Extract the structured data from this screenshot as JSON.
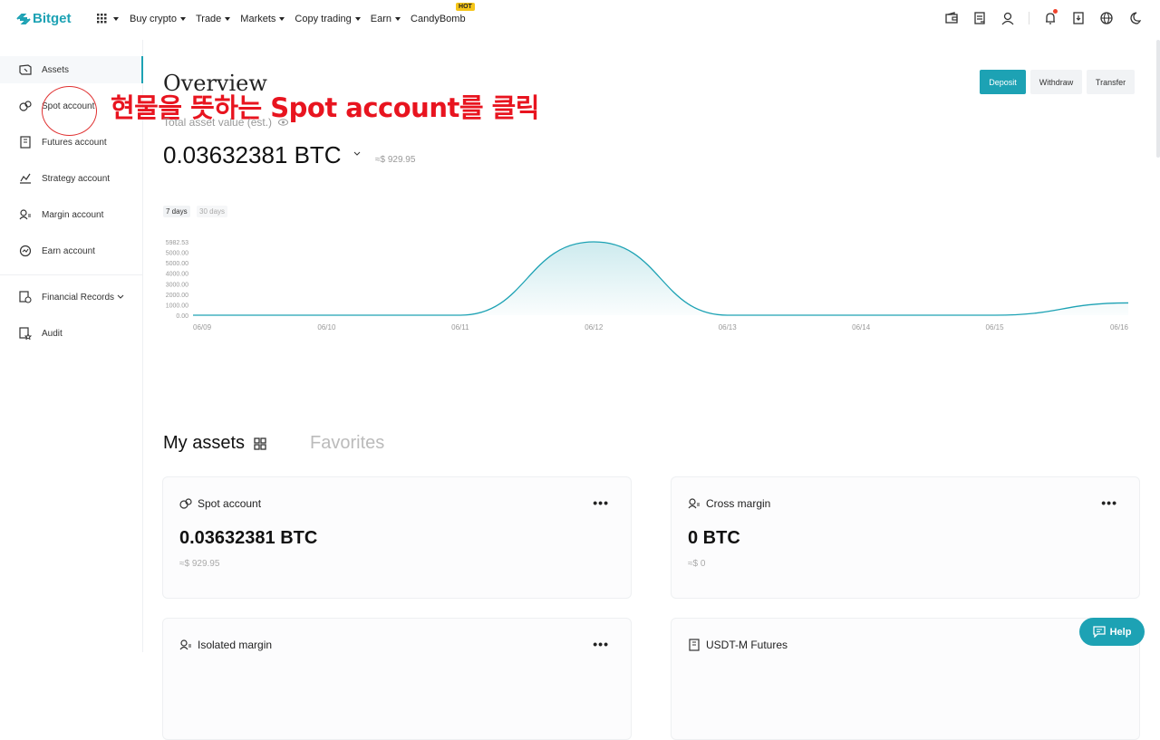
{
  "brand": {
    "name": "Bitget"
  },
  "nav": {
    "items": [
      {
        "label": "Buy crypto",
        "dropdown": true
      },
      {
        "label": "Trade",
        "dropdown": true
      },
      {
        "label": "Markets",
        "dropdown": true
      },
      {
        "label": "Copy trading",
        "dropdown": true
      },
      {
        "label": "Earn",
        "dropdown": true
      },
      {
        "label": "CandyBomb",
        "dropdown": false
      }
    ],
    "hot_badge": "HOT"
  },
  "header_icons": [
    "wallet-icon",
    "orders-icon",
    "user-icon",
    "bell-icon",
    "download-icon",
    "globe-icon",
    "moon-icon"
  ],
  "sidebar": {
    "items": [
      {
        "label": "Assets",
        "icon": "assets-icon"
      },
      {
        "label": "Spot account",
        "icon": "spot-icon"
      },
      {
        "label": "Futures account",
        "icon": "futures-icon"
      },
      {
        "label": "Strategy account",
        "icon": "strategy-icon"
      },
      {
        "label": "Margin account",
        "icon": "margin-icon"
      },
      {
        "label": "Earn account",
        "icon": "earn-icon"
      },
      {
        "label": "Financial Records",
        "icon": "records-icon"
      },
      {
        "label": "Audit",
        "icon": "audit-icon"
      }
    ]
  },
  "annotation": {
    "text": "현물을 뜻하는 Spot account를 클릭"
  },
  "overview": {
    "title": "Overview",
    "total_label": "Total asset value (est.)",
    "balance": "0.03632381 BTC",
    "balance_usd": "≈$ 929.95",
    "buttons": {
      "deposit": "Deposit",
      "withdraw": "Withdraw",
      "transfer": "Transfer"
    },
    "ranges": {
      "r7": "7 days",
      "r30": "30 days"
    }
  },
  "chart_data": {
    "type": "area",
    "x": [
      "06/09",
      "06/10",
      "06/11",
      "06/12",
      "06/13",
      "06/14",
      "06/15",
      "06/16"
    ],
    "y_ticks": [
      "5982.53",
      "5000.00",
      "5000.00",
      "4000.00",
      "3000.00",
      "2000.00",
      "1000.00",
      "0.00"
    ],
    "series": [
      {
        "values": [
          0,
          0,
          0,
          5982.53,
          0,
          0,
          0,
          1000
        ]
      }
    ],
    "ylim": [
      0,
      5982.53
    ],
    "grid": false,
    "color": "#1da2b4"
  },
  "assets": {
    "tab_my": "My assets",
    "tab_fav": "Favorites",
    "cards": [
      {
        "title": "Spot account",
        "value": "0.03632381 BTC",
        "usd": "≈$ 929.95",
        "icon": "spot-icon"
      },
      {
        "title": "Cross margin",
        "value": "0 BTC",
        "usd": "≈$ 0",
        "icon": "margin-icon"
      },
      {
        "title": "Isolated margin",
        "value": "",
        "usd": "",
        "icon": "margin-icon"
      },
      {
        "title": "USDT-M Futures",
        "value": "",
        "usd": "",
        "icon": "futures-icon"
      }
    ],
    "more": "•••"
  },
  "help": {
    "label": "Help"
  }
}
